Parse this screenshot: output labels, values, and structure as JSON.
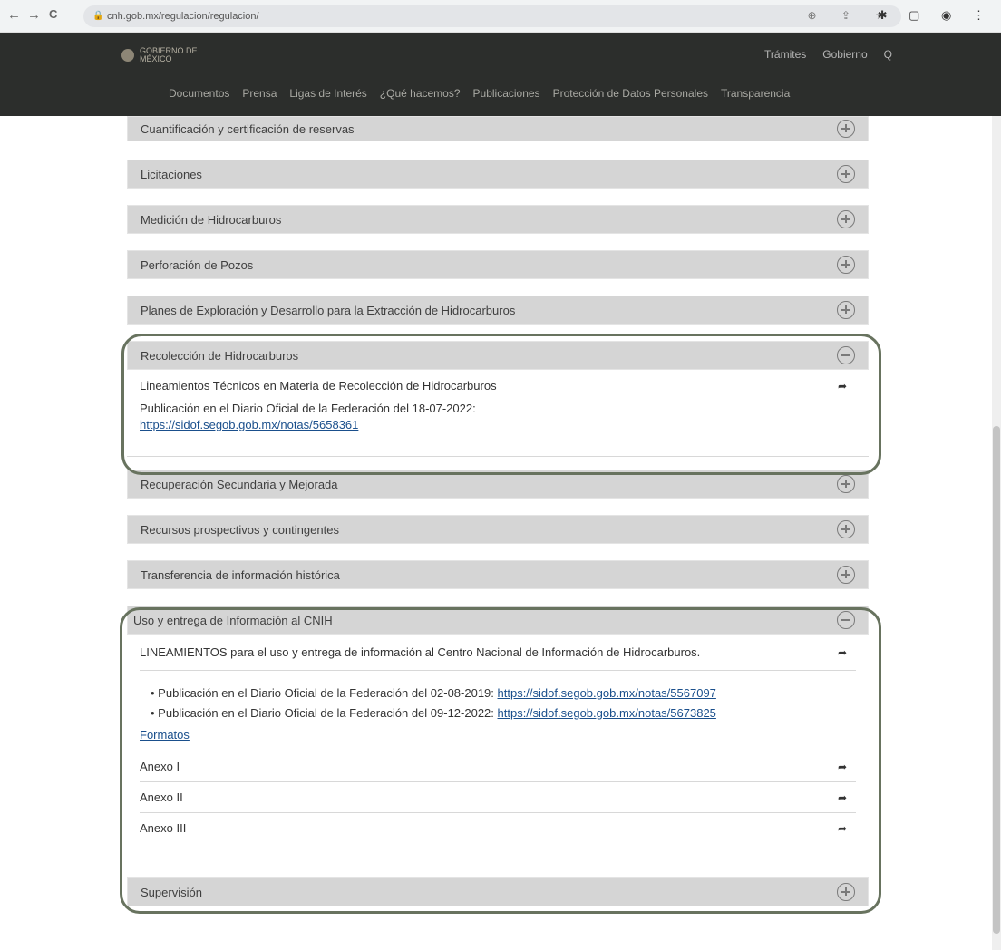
{
  "browser": {
    "url": "cnh.gob.mx/regulacion/regulacion/",
    "nav_back": "←",
    "nav_forward": "→",
    "nav_reload": "C",
    "lock": "🔒",
    "url_icons": "⊕ ⇪ ☆",
    "ext_icons": "✱ ▢ ◉ ⋮"
  },
  "header": {
    "logo_top": "GOBIERNO DE",
    "logo_bottom": "MÉXICO",
    "links": [
      "Trámites",
      "Gobierno"
    ],
    "search_icon": "Q"
  },
  "subnav": [
    "Documentos",
    "Prensa",
    "Ligas de Interés",
    "¿Qué hacemos?",
    "Publicaciones",
    "Protección de Datos Personales",
    "Transparencia"
  ],
  "panels": {
    "p1": "Cuantificación y certificación de reservas",
    "p2": "Licitaciones",
    "p3": "Medición de Hidrocarburos",
    "p4": "Perforación de Pozos",
    "p5": "Planes de Exploración y Desarrollo para la Extracción de Hidrocarburos",
    "p6": "Recolección de Hidrocarburos",
    "p7": "Recuperación Secundaria y Mejorada",
    "p8": "Recursos prospectivos y contingentes",
    "p9": "Transferencia de información histórica",
    "p10": "Uso y entrega de Información al CNIH",
    "p11": "Supervisión"
  },
  "recoleccion": {
    "lineamientos": "Lineamientos Técnicos en Materia de Recolección de Hidrocarburos",
    "publicacion": "Publicación en el Diario Oficial de la Federación del 18-07-2022:",
    "link": "https://sidof.segob.gob.mx/notas/5658361"
  },
  "uso": {
    "lineamientos": "LINEAMIENTOS para el uso y entrega de información al Centro Nacional de Información de Hidrocarburos.",
    "pub1_text": "Publicación en el Diario Oficial de la Federación del 02-08-2019:",
    "pub1_link": "https://sidof.segob.gob.mx/notas/5567097",
    "pub2_text": "Publicación en el Diario Oficial de la Federación del 09-12-2022:",
    "pub2_link": "https://sidof.segob.gob.mx/notas/5673825",
    "formatos": "Formatos",
    "anexos": [
      "Anexo I",
      "Anexo II",
      "Anexo III"
    ]
  },
  "colors": {
    "header_bg": "#2c2e2c",
    "panel_bg": "#d5d5d5",
    "outline": "#68735f",
    "link": "#1a4f8c"
  }
}
